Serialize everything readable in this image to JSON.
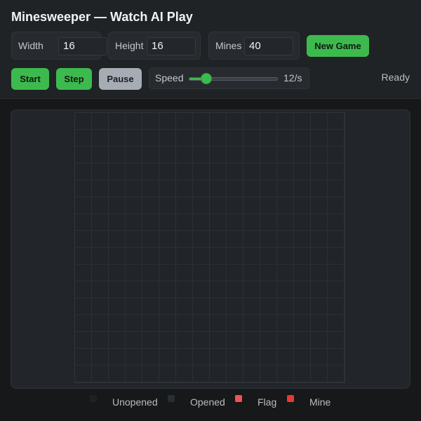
{
  "app": {
    "title": "Minesweeper — Watch AI Play"
  },
  "controls": {
    "width": {
      "label": "Width",
      "value": "16"
    },
    "height": {
      "label": "Height",
      "value": "16"
    },
    "mines": {
      "label": "Mines",
      "value": "40"
    },
    "new_game_label": "New Game",
    "start_label": "Start",
    "step_label": "Step",
    "pause_label": "Pause",
    "speed": {
      "label": "Speed",
      "value_text": "12/s",
      "fraction": 0.2
    },
    "status": "Ready"
  },
  "board": {
    "columns": 16,
    "rows": 16,
    "cell_state": "unopened"
  },
  "legend": [
    {
      "label": "Unopened",
      "color": "#1e2124"
    },
    {
      "label": "Opened",
      "color": "#2a2e33"
    },
    {
      "label": "Flag",
      "color": "#f05252"
    },
    {
      "label": "Mine",
      "color": "#e53935"
    }
  ],
  "colors": {
    "accent_green": "#3dba4e",
    "pause_gray": "#a6acb3"
  }
}
